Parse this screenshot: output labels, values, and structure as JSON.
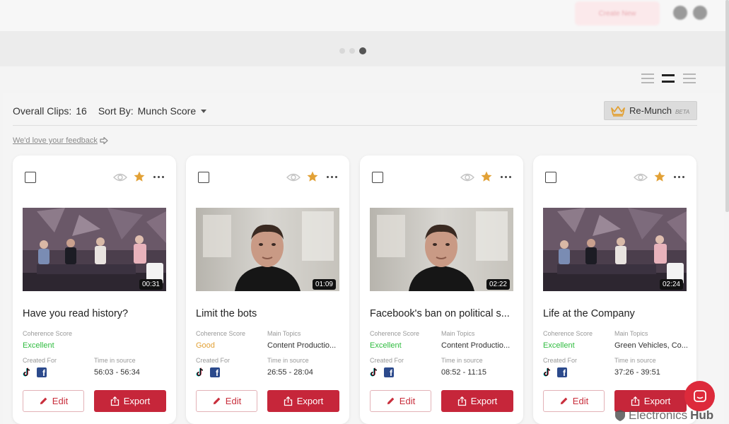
{
  "header": {
    "create_new_label": "Create New"
  },
  "carousel": {
    "dot_count": 3,
    "active_index": 2
  },
  "view_modes": [
    "list-view",
    "card-view",
    "compact-view"
  ],
  "toolbar": {
    "overall_clips_label": "Overall Clips:",
    "overall_clips_count": "16",
    "sort_by_label": "Sort By:",
    "sort_by_value": "Munch Score",
    "remunch_label": "Re-Munch",
    "remunch_badge": "BETA",
    "feedback_link": "We'd love your feedback"
  },
  "labels": {
    "coherence_score": "Coherence Score",
    "main_topics": "Main Topics",
    "created_for": "Created For",
    "time_in_source": "Time in source",
    "edit": "Edit",
    "export": "Export"
  },
  "clips": [
    {
      "title": "Have you read history?",
      "duration": "00:31",
      "coherence": "Excellent",
      "coherence_level": "excellent",
      "main_topics": "",
      "time_in_source": "56:03 - 56:34",
      "starred": true,
      "thumbnail": "panel"
    },
    {
      "title": "Limit the bots",
      "duration": "01:09",
      "coherence": "Good",
      "coherence_level": "good",
      "main_topics": "Content Productio...",
      "time_in_source": "26:55 - 28:04",
      "starred": true,
      "thumbnail": "speaker"
    },
    {
      "title": "Facebook's ban on political s...",
      "duration": "02:22",
      "coherence": "Excellent",
      "coherence_level": "excellent",
      "main_topics": "Content Productio...",
      "time_in_source": "08:52 - 11:15",
      "starred": true,
      "thumbnail": "speaker"
    },
    {
      "title": "Life at the Company",
      "duration": "02:24",
      "coherence": "Excellent",
      "coherence_level": "excellent",
      "main_topics": "Green Vehicles, Co...",
      "time_in_source": "37:26 - 39:51",
      "starred": true,
      "thumbnail": "panel"
    }
  ],
  "watermark": {
    "prefix": "Electronics",
    "suffix": "Hub"
  },
  "colors": {
    "accent": "#c6263a",
    "star": "#e2a136",
    "excellent": "#2fbc3f",
    "good": "#e2a136"
  }
}
